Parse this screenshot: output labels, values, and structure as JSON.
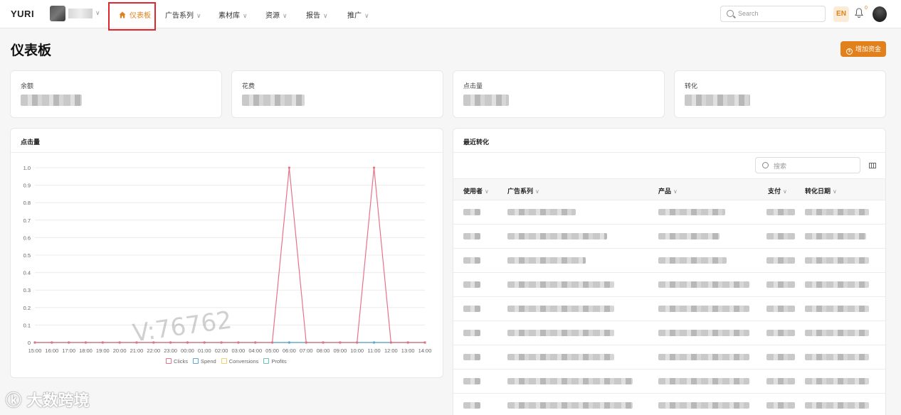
{
  "app": {
    "logo": "YURI"
  },
  "nav": {
    "items": [
      {
        "label": "仪表板",
        "active": true
      },
      {
        "label": "广告系列"
      },
      {
        "label": "素材库"
      },
      {
        "label": "资源"
      },
      {
        "label": "报告"
      },
      {
        "label": "推广"
      }
    ]
  },
  "header": {
    "search_placeholder": "Search",
    "lang": "EN",
    "notification_count": "0"
  },
  "page": {
    "title": "仪表板",
    "add_funds_label": "增加资金"
  },
  "stats": [
    {
      "label": "余额"
    },
    {
      "label": "花费"
    },
    {
      "label": "点击量"
    },
    {
      "label": "转化"
    }
  ],
  "chart_panel": {
    "title": "点击量"
  },
  "chart_data": {
    "type": "line",
    "x": [
      "15:00",
      "16:00",
      "17:00",
      "18:00",
      "19:00",
      "20:00",
      "21:00",
      "22:00",
      "23:00",
      "00:00",
      "01:00",
      "02:00",
      "03:00",
      "04:00",
      "05:00",
      "06:00",
      "07:00",
      "08:00",
      "09:00",
      "10:00",
      "11:00",
      "12:00",
      "13:00",
      "14:00"
    ],
    "ylim": [
      0,
      1.0
    ],
    "yticks": [
      "0",
      "0.1",
      "0.2",
      "0.3",
      "0.4",
      "0.5",
      "0.6",
      "0.7",
      "0.8",
      "0.9",
      "1.0"
    ],
    "series": [
      {
        "name": "Clicks",
        "color": "#e8728a",
        "values": [
          0,
          0,
          0,
          0,
          0,
          0,
          0,
          0,
          0,
          0,
          0,
          0,
          0,
          0,
          0,
          1,
          0,
          0,
          0,
          0,
          1,
          0,
          0,
          0
        ]
      },
      {
        "name": "Spend",
        "color": "#5aa9d6",
        "values": [
          0,
          0,
          0,
          0,
          0,
          0,
          0,
          0,
          0,
          0,
          0,
          0,
          0,
          0,
          0,
          0,
          0,
          0,
          0,
          0,
          0,
          0,
          0,
          0
        ]
      },
      {
        "name": "Conversions",
        "color": "#f2d06b",
        "values": [
          0,
          0,
          0,
          0,
          0,
          0,
          0,
          0,
          0,
          0,
          0,
          0,
          0,
          0,
          0,
          0,
          0,
          0,
          0,
          0,
          0,
          0,
          0,
          0
        ]
      },
      {
        "name": "Profits",
        "color": "#6cc3b5",
        "values": [
          0,
          0,
          0,
          0,
          0,
          0,
          0,
          0,
          0,
          0,
          0,
          0,
          0,
          0,
          0,
          0,
          0,
          0,
          0,
          0,
          0,
          0,
          0,
          0
        ]
      }
    ],
    "grid": true,
    "legend": "bottom-center"
  },
  "conversions_panel": {
    "title": "最近转化",
    "search_placeholder": "搜索",
    "columns": [
      "使用者",
      "广告系列",
      "产品",
      "支付",
      "转化日期"
    ]
  },
  "watermark": "V:76762",
  "brand_watermark": "大数跨境"
}
